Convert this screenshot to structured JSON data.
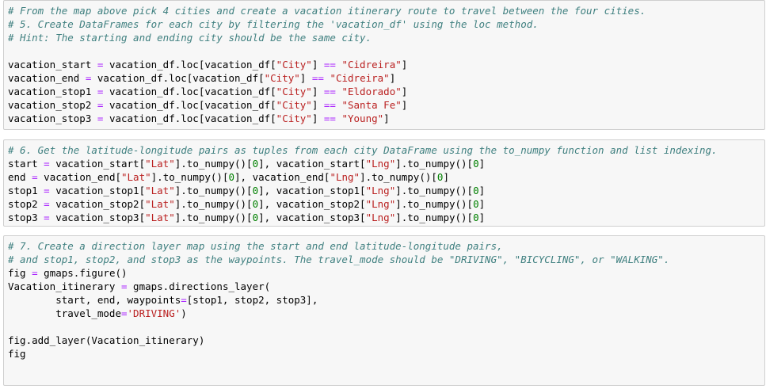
{
  "cells": [
    {
      "lines": [
        [
          {
            "t": "# From the map above pick 4 cities and create a vacation itinerary route to travel between the four cities.",
            "c": "cm"
          }
        ],
        [
          {
            "t": "# 5. Create DataFrames for each city by filtering the 'vacation_df' using the loc method.",
            "c": "cm"
          }
        ],
        [
          {
            "t": "# Hint: The starting and ending city should be the same city.",
            "c": "cm"
          }
        ],
        [],
        [
          {
            "t": "vacation_start "
          },
          {
            "t": "=",
            "c": "op"
          },
          {
            "t": " vacation_df.loc[vacation_df["
          },
          {
            "t": "\"City\"",
            "c": "st"
          },
          {
            "t": "] "
          },
          {
            "t": "==",
            "c": "op"
          },
          {
            "t": " "
          },
          {
            "t": "\"Cidreira\"",
            "c": "st"
          },
          {
            "t": "]"
          }
        ],
        [
          {
            "t": "vacation_end "
          },
          {
            "t": "=",
            "c": "op"
          },
          {
            "t": " vacation_df.loc[vacation_df["
          },
          {
            "t": "\"City\"",
            "c": "st"
          },
          {
            "t": "] "
          },
          {
            "t": "==",
            "c": "op"
          },
          {
            "t": " "
          },
          {
            "t": "\"Cidreira\"",
            "c": "st"
          },
          {
            "t": "]"
          }
        ],
        [
          {
            "t": "vacation_stop1 "
          },
          {
            "t": "=",
            "c": "op"
          },
          {
            "t": " vacation_df.loc[vacation_df["
          },
          {
            "t": "\"City\"",
            "c": "st"
          },
          {
            "t": "] "
          },
          {
            "t": "==",
            "c": "op"
          },
          {
            "t": " "
          },
          {
            "t": "\"Eldorado\"",
            "c": "st"
          },
          {
            "t": "]"
          }
        ],
        [
          {
            "t": "vacation_stop2 "
          },
          {
            "t": "=",
            "c": "op"
          },
          {
            "t": " vacation_df.loc[vacation_df["
          },
          {
            "t": "\"City\"",
            "c": "st"
          },
          {
            "t": "] "
          },
          {
            "t": "==",
            "c": "op"
          },
          {
            "t": " "
          },
          {
            "t": "\"Santa Fe\"",
            "c": "st"
          },
          {
            "t": "]"
          }
        ],
        [
          {
            "t": "vacation_stop3 "
          },
          {
            "t": "=",
            "c": "op"
          },
          {
            "t": " vacation_df.loc[vacation_df["
          },
          {
            "t": "\"City\"",
            "c": "st"
          },
          {
            "t": "] "
          },
          {
            "t": "==",
            "c": "op"
          },
          {
            "t": " "
          },
          {
            "t": "\"Young\"",
            "c": "st"
          },
          {
            "t": "]"
          }
        ]
      ]
    },
    {
      "lines": [
        [
          {
            "t": "# 6. Get the latitude-longitude pairs as tuples from each city DataFrame using the to_numpy function and list indexing.",
            "c": "cm"
          }
        ],
        [
          {
            "t": "start "
          },
          {
            "t": "=",
            "c": "op"
          },
          {
            "t": " vacation_start["
          },
          {
            "t": "\"Lat\"",
            "c": "st"
          },
          {
            "t": "].to_numpy()["
          },
          {
            "t": "0",
            "c": "nb"
          },
          {
            "t": "], vacation_start["
          },
          {
            "t": "\"Lng\"",
            "c": "st"
          },
          {
            "t": "].to_numpy()["
          },
          {
            "t": "0",
            "c": "nb"
          },
          {
            "t": "]"
          }
        ],
        [
          {
            "t": "end "
          },
          {
            "t": "=",
            "c": "op"
          },
          {
            "t": " vacation_end["
          },
          {
            "t": "\"Lat\"",
            "c": "st"
          },
          {
            "t": "].to_numpy()["
          },
          {
            "t": "0",
            "c": "nb"
          },
          {
            "t": "], vacation_end["
          },
          {
            "t": "\"Lng\"",
            "c": "st"
          },
          {
            "t": "].to_numpy()["
          },
          {
            "t": "0",
            "c": "nb"
          },
          {
            "t": "]"
          }
        ],
        [
          {
            "t": "stop1 "
          },
          {
            "t": "=",
            "c": "op"
          },
          {
            "t": " vacation_stop1["
          },
          {
            "t": "\"Lat\"",
            "c": "st"
          },
          {
            "t": "].to_numpy()["
          },
          {
            "t": "0",
            "c": "nb"
          },
          {
            "t": "], vacation_stop1["
          },
          {
            "t": "\"Lng\"",
            "c": "st"
          },
          {
            "t": "].to_numpy()["
          },
          {
            "t": "0",
            "c": "nb"
          },
          {
            "t": "]"
          }
        ],
        [
          {
            "t": "stop2 "
          },
          {
            "t": "=",
            "c": "op"
          },
          {
            "t": " vacation_stop2["
          },
          {
            "t": "\"Lat\"",
            "c": "st"
          },
          {
            "t": "].to_numpy()["
          },
          {
            "t": "0",
            "c": "nb"
          },
          {
            "t": "], vacation_stop2["
          },
          {
            "t": "\"Lng\"",
            "c": "st"
          },
          {
            "t": "].to_numpy()["
          },
          {
            "t": "0",
            "c": "nb"
          },
          {
            "t": "]"
          }
        ],
        [
          {
            "t": "stop3 "
          },
          {
            "t": "=",
            "c": "op"
          },
          {
            "t": " vacation_stop3["
          },
          {
            "t": "\"Lat\"",
            "c": "st"
          },
          {
            "t": "].to_numpy()["
          },
          {
            "t": "0",
            "c": "nb"
          },
          {
            "t": "], vacation_stop3["
          },
          {
            "t": "\"Lng\"",
            "c": "st"
          },
          {
            "t": "].to_numpy()["
          },
          {
            "t": "0",
            "c": "nb"
          },
          {
            "t": "]"
          }
        ]
      ]
    },
    {
      "lines": [
        [
          {
            "t": "# 7. Create a direction layer map using the start and end latitude-longitude pairs,",
            "c": "cm"
          }
        ],
        [
          {
            "t": "# and stop1, stop2, and stop3 as the waypoints. The travel_mode should be \"DRIVING\", \"BICYCLING\", or \"WALKING\".",
            "c": "cm"
          }
        ],
        [
          {
            "t": "fig "
          },
          {
            "t": "=",
            "c": "op"
          },
          {
            "t": " gmaps.figure()"
          }
        ],
        [
          {
            "t": "Vacation_itinerary "
          },
          {
            "t": "=",
            "c": "op"
          },
          {
            "t": " gmaps.directions_layer("
          }
        ],
        [
          {
            "t": "        start, end, waypoints"
          },
          {
            "t": "=",
            "c": "op"
          },
          {
            "t": "[stop1, stop2, stop3],"
          }
        ],
        [
          {
            "t": "        travel_mode"
          },
          {
            "t": "=",
            "c": "op"
          },
          {
            "t": "'DRIVING'",
            "c": "st"
          },
          {
            "t": ")"
          }
        ],
        [],
        [
          {
            "t": "fig.add_layer(Vacation_itinerary)"
          }
        ],
        [
          {
            "t": "fig"
          }
        ]
      ]
    }
  ],
  "colors": {
    "comment": "#408080",
    "string": "#ba2121",
    "operator": "#aa22ff",
    "number": "#008000",
    "cell_background": "#f7f7f7",
    "cell_border": "#cfcfcf"
  }
}
